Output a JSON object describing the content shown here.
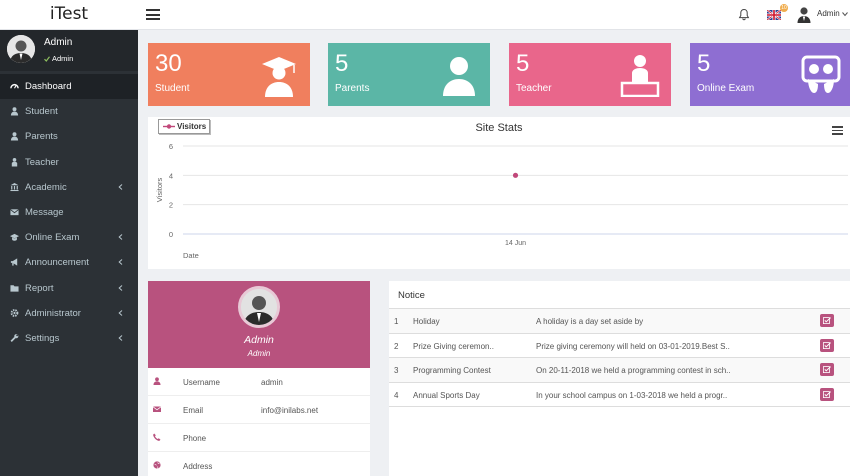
{
  "header": {
    "brand": "iTest",
    "user_name": "Admin",
    "flag_badge": "10",
    "icons": [
      "menu-icon",
      "bell-icon",
      "uk-flag-icon",
      "user-avatar-icon",
      "caret-down-icon"
    ]
  },
  "sidebar": {
    "user": {
      "name": "Admin",
      "role": "Admin"
    },
    "items": [
      {
        "label": "Dashboard",
        "icon": "dashboard-icon",
        "active": true,
        "has_children": false
      },
      {
        "label": "Student",
        "icon": "user-icon",
        "has_children": false
      },
      {
        "label": "Parents",
        "icon": "user-icon",
        "has_children": false
      },
      {
        "label": "Teacher",
        "icon": "teacher-icon",
        "has_children": false
      },
      {
        "label": "Academic",
        "icon": "bank-icon",
        "has_children": true
      },
      {
        "label": "Message",
        "icon": "envelope-icon",
        "has_children": false
      },
      {
        "label": "Online Exam",
        "icon": "graduation-cap-icon",
        "has_children": true
      },
      {
        "label": "Announcement",
        "icon": "bullhorn-icon",
        "has_children": true
      },
      {
        "label": "Report",
        "icon": "folder-icon",
        "has_children": true
      },
      {
        "label": "Administrator",
        "icon": "gears-icon",
        "has_children": true
      },
      {
        "label": "Settings",
        "icon": "wrench-icon",
        "has_children": true
      }
    ]
  },
  "stat_boxes": [
    {
      "count": "30",
      "label": "Student",
      "color": "#f07f5e",
      "icon": "graduate-icon"
    },
    {
      "count": "5",
      "label": "Parents",
      "color": "#5bb6a6",
      "icon": "user-icon"
    },
    {
      "count": "5",
      "label": "Teacher",
      "color": "#e9668b",
      "icon": "teacher-desk-icon"
    },
    {
      "count": "5",
      "label": "Online Exam",
      "color": "#8e6ed2",
      "icon": "slideshare-icon"
    }
  ],
  "site_stats": {
    "title": "Site Stats",
    "legend_label": "Visitors",
    "chart_data": {
      "type": "line",
      "title": "Site Stats",
      "xlabel": "Date",
      "ylabel": "Visitors",
      "categories": [
        "14 Jun"
      ],
      "series": [
        {
          "name": "Visitors",
          "values": [
            4
          ],
          "color": "#c1487a"
        }
      ],
      "ylim": [
        0,
        6
      ],
      "yticks": [
        0,
        2,
        4,
        6
      ],
      "grid": true,
      "legend": "top-left"
    }
  },
  "profile": {
    "name": "Admin",
    "role": "Admin",
    "rows": [
      {
        "label": "Username",
        "value": "admin",
        "icon": "user-icon"
      },
      {
        "label": "Email",
        "value": "info@inilabs.net",
        "icon": "envelope-icon"
      },
      {
        "label": "Phone",
        "value": "",
        "icon": "phone-icon"
      },
      {
        "label": "Address",
        "value": "",
        "icon": "globe-icon"
      }
    ]
  },
  "notice": {
    "title": "Notice",
    "rows": [
      {
        "num": "1",
        "title": "Holiday",
        "notice": "A holiday is a day set aside by"
      },
      {
        "num": "2",
        "title": "Prize Giving ceremon..",
        "notice": "Prize giving ceremony will held on 03-01-2019.Best S.."
      },
      {
        "num": "3",
        "title": "Programming Contest",
        "notice": "On 20-11-2018 we held a programming contest in sch.."
      },
      {
        "num": "4",
        "title": "Annual Sports Day",
        "notice": "In your school campus on 1-03-2018 we held a progr.."
      }
    ]
  }
}
